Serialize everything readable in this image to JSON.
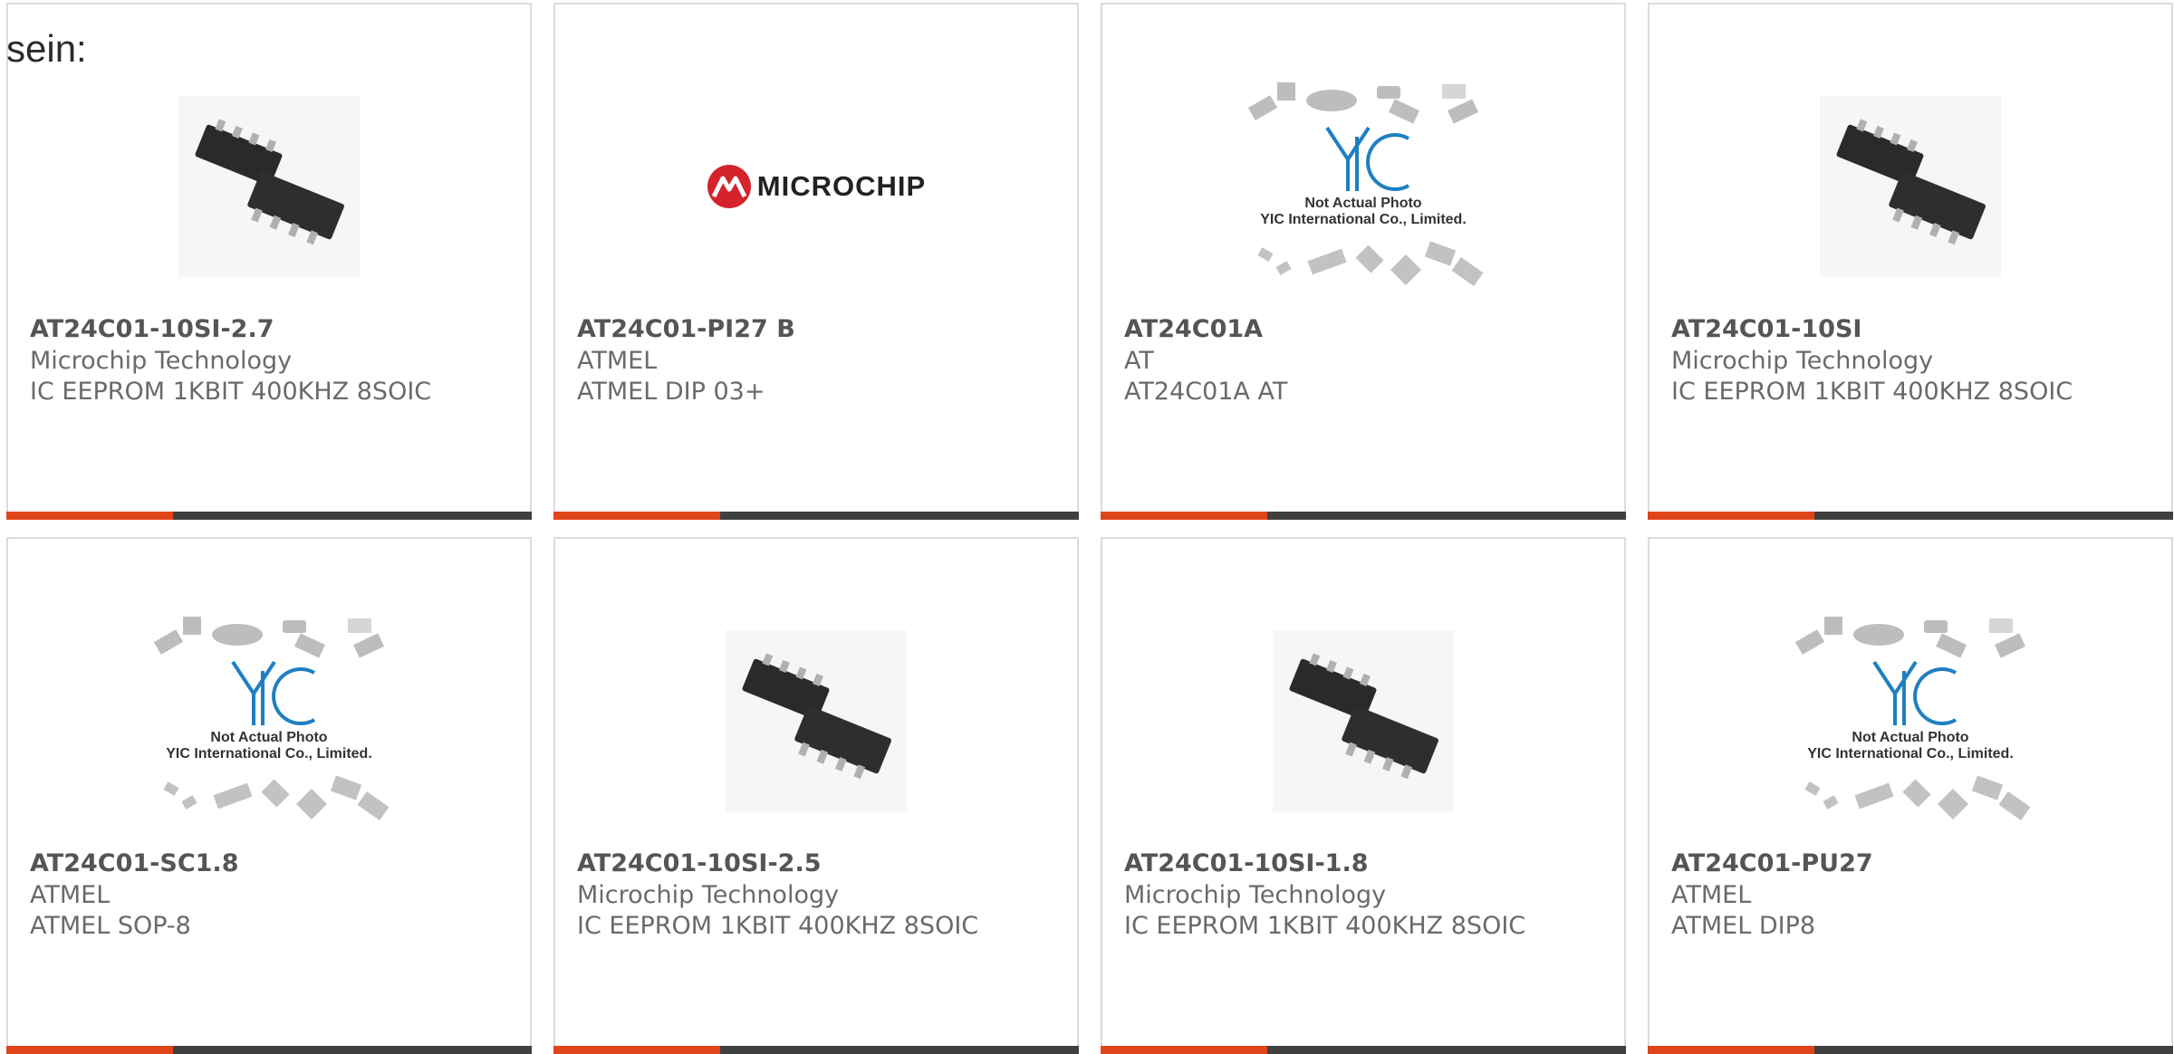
{
  "intro_text": "sein:",
  "products": [
    {
      "part": "AT24C01-10SI-2.7",
      "manufacturer": "Microchip Technology",
      "description": "IC EEPROM 1KBIT 400KHZ 8SOIC",
      "image": "chip-photo"
    },
    {
      "part": "AT24C01-PI27 B",
      "manufacturer": "ATMEL",
      "description": "ATMEL DIP 03+",
      "image": "microchip-logo"
    },
    {
      "part": "AT24C01A",
      "manufacturer": "AT",
      "description": "AT24C01A AT",
      "image": "yic-placeholder"
    },
    {
      "part": "AT24C01-10SI",
      "manufacturer": "Microchip Technology",
      "description": "IC EEPROM 1KBIT 400KHZ 8SOIC",
      "image": "chip-photo"
    },
    {
      "part": "AT24C01-SC1.8",
      "manufacturer": "ATMEL",
      "description": "ATMEL SOP-8",
      "image": "yic-placeholder"
    },
    {
      "part": "AT24C01-10SI-2.5",
      "manufacturer": "Microchip Technology",
      "description": "IC EEPROM 1KBIT 400KHZ 8SOIC",
      "image": "chip-photo"
    },
    {
      "part": "AT24C01-10SI-1.8",
      "manufacturer": "Microchip Technology",
      "description": "IC EEPROM 1KBIT 400KHZ 8SOIC",
      "image": "chip-photo"
    },
    {
      "part": "AT24C01-PU27",
      "manufacturer": "ATMEL",
      "description": "ATMEL DIP8",
      "image": "yic-placeholder"
    }
  ],
  "logo": {
    "word": "MICROCHIP"
  },
  "placeholder": {
    "line1": "Not Actual Photo",
    "line2": "YIC International Co., Limited.",
    "brand": "YIC"
  },
  "colors": {
    "accent": "#e0451a",
    "bar": "#404040",
    "logo_red": "#d4232b",
    "yic_blue": "#1e7fc1"
  }
}
